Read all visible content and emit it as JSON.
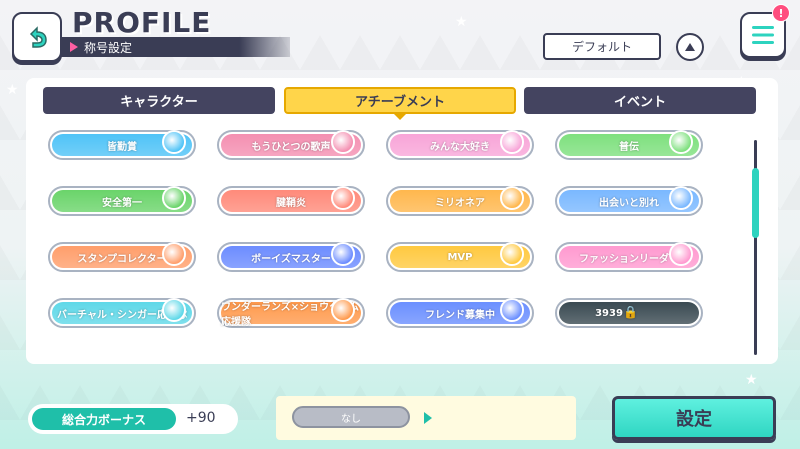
{
  "header": {
    "title": "PROFILE",
    "subtitle": "称号設定",
    "default_button": "デフォルト",
    "notification_badge": "!"
  },
  "tabs": [
    {
      "label": "キャラクター",
      "active": false
    },
    {
      "label": "アチーブメント",
      "active": true
    },
    {
      "label": "イベント",
      "active": false
    }
  ],
  "titles": [
    {
      "label": "皆勤賞",
      "color": "#4fc3f7",
      "icon": "book-icon"
    },
    {
      "label": "もうひとつの歌声",
      "color": "#f48fb1",
      "icon": "microphone-icon"
    },
    {
      "label": "みんな大好き",
      "color": "#f8a5d8",
      "icon": "hearts-icon"
    },
    {
      "label": "普伝",
      "color": "#7ee07e",
      "icon": "battery-icon"
    },
    {
      "label": "安全第一",
      "color": "#6ad46a",
      "icon": "burger-icon"
    },
    {
      "label": "腱鞘炎",
      "color": "#ff8a7a",
      "icon": "hand-icon"
    },
    {
      "label": "ミリオネア",
      "color": "#ffb74d",
      "icon": "coins-icon"
    },
    {
      "label": "出会いと別れ",
      "color": "#7ab8ff",
      "icon": "wave-hand-icon"
    },
    {
      "label": "スタンプコレクター",
      "color": "#ff9e6b",
      "icon": "stamp-icon"
    },
    {
      "label": "ボーイズマスター",
      "color": "#6c8cff",
      "icon": "boys-icon"
    },
    {
      "label": "MVP",
      "color": "#ffc940",
      "icon": "medal-icon"
    },
    {
      "label": "ファッションリーダー",
      "color": "#ff9ad0",
      "icon": "clothes-icon"
    },
    {
      "label": "バーチャル・シンガー応援隊",
      "color": "#5fd8e8",
      "icon": "glowstick-icon"
    },
    {
      "label": "ワンダーランズ×ショウタイム応援隊",
      "color": "#ff9a4d",
      "icon": "glowstick-icon"
    },
    {
      "label": "フレンド募集中",
      "color": "#6b8fff",
      "icon": "friend-icon"
    },
    {
      "label": "3939",
      "color": "#3a4a52",
      "icon": "lock-icon",
      "locked": true
    }
  ],
  "footer": {
    "bonus_label": "総合力ボーナス",
    "bonus_value": "+90",
    "effect_label": "なし",
    "set_button": "設定"
  }
}
